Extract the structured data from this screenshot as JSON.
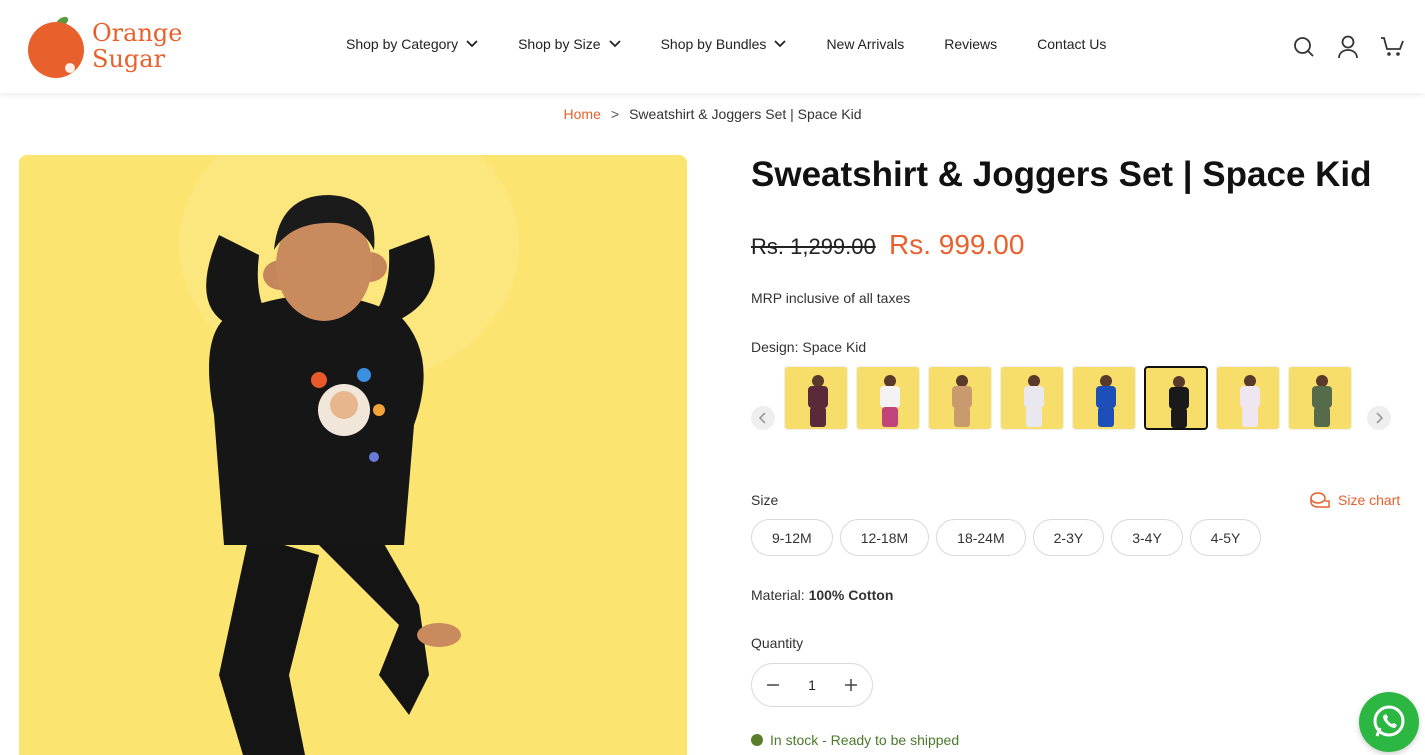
{
  "brand": {
    "name_line1": "Orange",
    "name_line2": "Sugar",
    "accent": "#e8602c"
  },
  "nav": {
    "items": [
      {
        "label": "Shop by Category",
        "dropdown": true
      },
      {
        "label": "Shop by Size",
        "dropdown": true
      },
      {
        "label": "Shop by Bundles",
        "dropdown": true
      },
      {
        "label": "New Arrivals",
        "dropdown": false
      },
      {
        "label": "Reviews",
        "dropdown": false
      },
      {
        "label": "Contact Us",
        "dropdown": false
      }
    ],
    "icons": [
      "search-icon",
      "account-icon",
      "cart-icon"
    ]
  },
  "breadcrumb": {
    "home": "Home",
    "separator": ">",
    "current": "Sweatshirt & Joggers Set | Space Kid"
  },
  "product": {
    "title": "Sweatshirt & Joggers Set | Space Kid",
    "price_old": "Rs. 1,299.00",
    "price_new": "Rs. 999.00",
    "tax_note": "MRP inclusive of all taxes",
    "design_label": "Design: Space Kid",
    "swatches": [
      {
        "top": "#5b2a3a",
        "bottom": "#5b2a3a"
      },
      {
        "top": "#f3f3f3",
        "bottom": "#c0457a"
      },
      {
        "top": "#c89a6d",
        "bottom": "#c89a6d"
      },
      {
        "top": "#e8e8ee",
        "bottom": "#e8e8ee"
      },
      {
        "top": "#1d4fb8",
        "bottom": "#1d4fb8"
      },
      {
        "top": "#1a1a1a",
        "bottom": "#1a1a1a",
        "selected": true
      },
      {
        "top": "#efe6f2",
        "bottom": "#efe6f2"
      },
      {
        "top": "#556b4a",
        "bottom": "#556b4a"
      }
    ],
    "size_label": "Size",
    "size_chart_label": "Size chart",
    "sizes": [
      "9-12M",
      "12-18M",
      "18-24M",
      "2-3Y",
      "3-4Y",
      "4-5Y"
    ],
    "material_prefix": "Material:",
    "material_value": "100% Cotton",
    "quantity_label": "Quantity",
    "quantity_value": "1",
    "stock_text": "In stock - Ready to be shipped"
  }
}
